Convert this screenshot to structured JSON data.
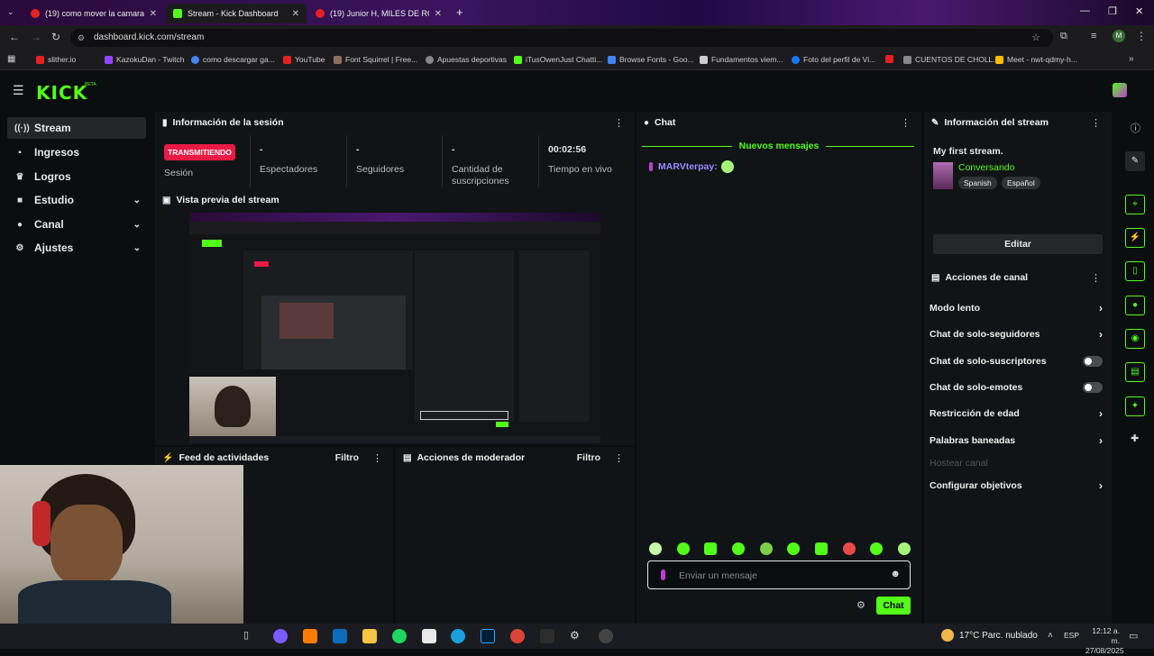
{
  "browser": {
    "tabs": [
      {
        "label": "(19) como mover la camara en",
        "active": false
      },
      {
        "label": "Stream - Kick Dashboard",
        "active": true
      },
      {
        "label": "(19) Junior H, MILES DE ROSAS",
        "active": false
      }
    ],
    "url": "dashboard.kick.com/stream",
    "profile_initial": "M",
    "bookmarks": [
      "slither.io",
      "KazokuDan - Twitch",
      "como descargar ga...",
      "YouTube",
      "Font Squirrel | Free...",
      "Apuestas deportivas",
      "iTusOwenJust Chatti...",
      "Browse Fonts - Goo...",
      "Fundamentos viem...",
      "Foto del perfil de Vi...",
      "CUENTOS DE CHOLL...",
      "Meet - nwt-qdmy-h..."
    ]
  },
  "app": {
    "logo": "KICK",
    "beta": "BETA"
  },
  "sidebar": {
    "items": [
      {
        "label": "Stream",
        "icon": "broadcast-icon",
        "active": true
      },
      {
        "label": "Ingresos",
        "icon": "money-icon"
      },
      {
        "label": "Logros",
        "icon": "trophy-icon"
      },
      {
        "label": "Estudio",
        "icon": "camera-icon",
        "expandable": true
      },
      {
        "label": "Canal",
        "icon": "person-icon",
        "expandable": true
      },
      {
        "label": "Ajustes",
        "icon": "gear-icon",
        "expandable": true
      }
    ]
  },
  "session": {
    "title": "Información de la sesión",
    "badge": "TRANSMITIENDO",
    "session_label": "Sesión",
    "stats": [
      {
        "value": "-",
        "label": "Espectadores"
      },
      {
        "value": "-",
        "label": "Seguidores"
      },
      {
        "value": "-",
        "label": "Cantidad de suscripciones"
      },
      {
        "value": "00:02:56",
        "label": "Tiempo en vivo"
      }
    ]
  },
  "preview": {
    "title": "Vista previa del stream"
  },
  "feed": {
    "title": "Feed de actividades",
    "filter": "Filtro"
  },
  "moderator": {
    "title": "Acciones de moderador",
    "filter": "Filtro"
  },
  "chat": {
    "title": "Chat",
    "new_messages": "Nuevos mensajes",
    "message_user": "MARVterpay:",
    "placeholder": "Enviar un mensaje",
    "send": "Chat"
  },
  "stream_info": {
    "title": "Información del stream",
    "stream_title": "My first stream.",
    "category": "Conversando",
    "tags": [
      "Spanish",
      "Español"
    ],
    "edit": "Editar"
  },
  "channel_actions": {
    "title": "Acciones de canal",
    "items": [
      {
        "label": "Modo lento",
        "control": "arrow"
      },
      {
        "label": "Chat de solo-seguidores",
        "control": "arrow"
      },
      {
        "label": "Chat de solo-suscriptores",
        "control": "toggle"
      },
      {
        "label": "Chat de solo-emotes",
        "control": "toggle"
      },
      {
        "label": "Restricción de edad",
        "control": "arrow"
      },
      {
        "label": "Palabras baneadas",
        "control": "arrow"
      },
      {
        "label": "Hostear canal",
        "control": "none",
        "disabled": true
      },
      {
        "label": "Configurar objetivos",
        "control": "arrow"
      }
    ]
  },
  "taskbar": {
    "weather": "17°C  Parc. nublado",
    "lang": "ESP",
    "time": "12:12 a. m.",
    "date": "27/08/2025"
  },
  "colors": {
    "accent": "#53fc18",
    "live": "#e91a46",
    "panel": "#111416",
    "background": "#0b0e0f"
  }
}
